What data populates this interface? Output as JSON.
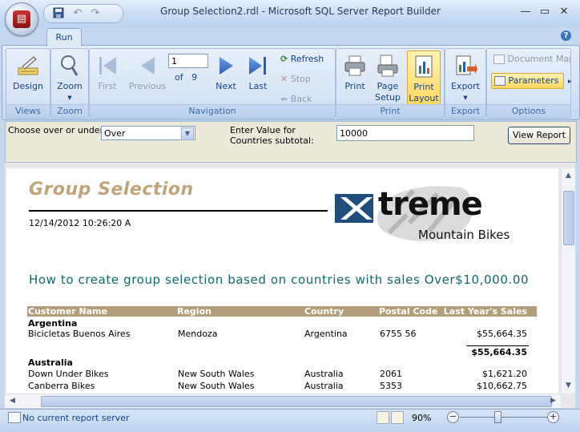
{
  "window": {
    "title": "Group Selection2.rdl - Microsoft SQL Server Report Builder",
    "minimize": "—",
    "maximize": "▭",
    "close": "✕"
  },
  "qat": {
    "save_icon": "save-icon",
    "undo_icon": "undo-icon",
    "redo_icon": "redo-icon"
  },
  "ribbon": {
    "tabs": [
      {
        "label": "Run"
      }
    ],
    "help": "?",
    "groups": {
      "views": {
        "label": "Views",
        "design": "Design"
      },
      "zoom": {
        "label": "Zoom",
        "zoom": "Zoom"
      },
      "navigation": {
        "label": "Navigation",
        "first": "First",
        "previous": "Previous",
        "page_value": "1",
        "of_label": "of",
        "total_pages": "9",
        "next": "Next",
        "last": "Last",
        "refresh": "Refresh",
        "stop": "Stop",
        "back": "Back"
      },
      "print": {
        "label": "Print",
        "print": "Print",
        "page_setup": [
          "Page",
          "Setup"
        ],
        "print_layout": [
          "Print",
          "Layout"
        ]
      },
      "export": {
        "label": "Export",
        "export": "Export"
      },
      "options": {
        "label": "Options",
        "document_map": "Document Map",
        "parameters": "Parameters"
      }
    }
  },
  "parameters": {
    "over_under_label": "Choose over or under",
    "over_under_value": "Over",
    "value_label": "Enter Value for Countries subtotal:",
    "value": "10000",
    "view_report": "View Report"
  },
  "report": {
    "title": "Group Selection",
    "date": "12/14/2012  10:26:20 A",
    "logo_text_1": "treme",
    "logo_text_2": "Mountain Bikes",
    "subtitle": "How to create group selection based on countries with sales Over$10,000.00",
    "columns": [
      "Customer Name",
      "Region",
      "Country",
      "Postal Code",
      "Last Year's Sales"
    ],
    "groups": [
      {
        "name": "Argentina",
        "rows": [
          [
            "Bicicletas Buenos Aires",
            "Mendoza",
            "Argentina",
            "6755 56",
            "$55,664.35"
          ]
        ],
        "subtotal": "$55,664.35"
      },
      {
        "name": "Australia",
        "rows": [
          [
            "Down Under Bikes",
            "New South Wales",
            "Australia",
            "2061",
            "$1,621.20"
          ],
          [
            "Canberra Bikes",
            "New South Wales",
            "Australia",
            "5353",
            "$10,662.75"
          ]
        ]
      }
    ]
  },
  "status": {
    "server": "No current report server",
    "zoom": "90%",
    "zoom_level_percent": 90
  },
  "colors": {
    "title_color": "#c1a57a",
    "subtitle_color": "#0b6b6f",
    "header_bg": "#b49d7a",
    "ribbon_text": "#15428b"
  }
}
